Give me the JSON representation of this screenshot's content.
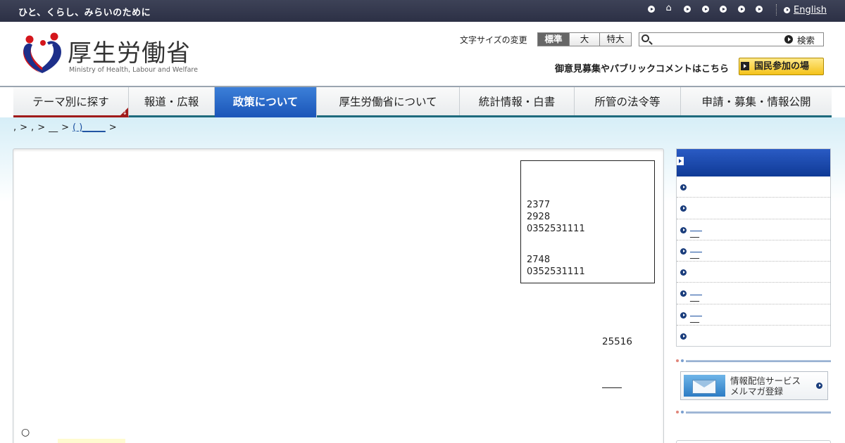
{
  "topbar": {
    "tagline": "ひと、くらし、みらいのために",
    "icons": [
      "bullet-arrow",
      "home",
      "bullet-arrow",
      "bullet-arrow",
      "bullet-arrow",
      "bullet-arrow",
      "bullet-arrow"
    ],
    "english_label": "English"
  },
  "header": {
    "logo_title": "厚生労働省",
    "logo_subtitle": "Ministry of Health, Labour and Welfare",
    "font_size_label": "文字サイズの変更",
    "font_size_options": [
      "標準",
      "大",
      "特大"
    ],
    "font_size_selected": "標準",
    "search_placeholder": "",
    "search_button": "検索",
    "opinion_text": "御意見募集やパブリックコメントはこちら",
    "citizen_button": "国民参加の場"
  },
  "nav": {
    "items": [
      {
        "label": "テーマ別に探す"
      },
      {
        "label": "報道・広報"
      },
      {
        "label": "政策について"
      },
      {
        "label": "厚生労働省について"
      },
      {
        "label": "統計情報・白書"
      },
      {
        "label": "所管の法令等"
      },
      {
        "label": "申請・募集・情報公開"
      }
    ],
    "active": "政策について"
  },
  "breadcrumb": {
    "parts": [
      ",",
      ">",
      ",",
      ">",
      "__",
      ">",
      "( )_____",
      ">"
    ]
  },
  "main": {
    "contact_block1": [
      "2377",
      "2928",
      "0352531111"
    ],
    "contact_block2": [
      "2748",
      "0352531111"
    ],
    "right_number": "25516",
    "bullet_glyph": "○"
  },
  "sidebar": {
    "items": [
      "",
      "",
      "__",
      "__",
      "",
      "__",
      "__",
      ""
    ]
  },
  "mail_banner": {
    "line1": "情報配信サービス",
    "line2": "メルマガ登録"
  },
  "colors": {
    "topbar": "#2c3045",
    "nav_active": "#1a55b8",
    "nav_underline": "#1d6a7d",
    "theme_red": "#a01a1a",
    "citizen_yellow": "#f4c21a"
  }
}
